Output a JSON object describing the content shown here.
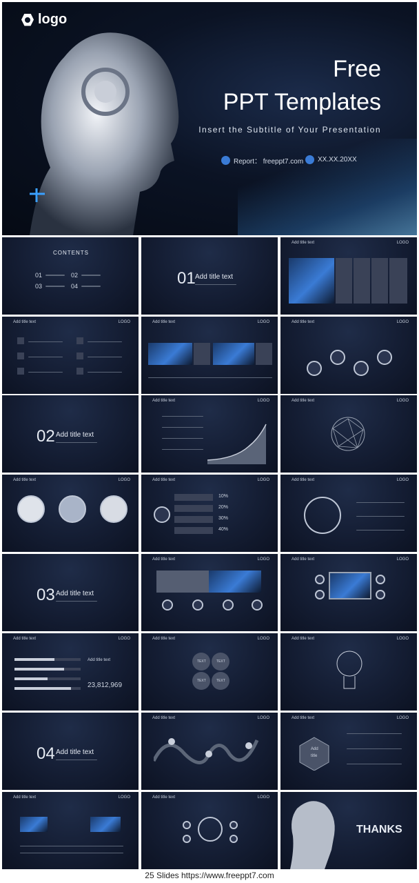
{
  "hero": {
    "logo_text": "logo",
    "title_line1": "Free",
    "title_line2": "PPT Templates",
    "subtitle": "Insert  the  Subtitle  of  Your  Presentation",
    "report": "Report： freeppt7.com",
    "date": "XX.XX.20XX"
  },
  "slides": {
    "contents": "CONTENTS",
    "header": "Add title text",
    "logo": "LOGO",
    "c1": "01",
    "c2": "02",
    "c3": "03",
    "c4": "04",
    "sec_title": "Add title text",
    "text_label": "TEXT",
    "number": "23,812,969",
    "pct1": "10%",
    "pct2": "20%",
    "pct3": "30%",
    "pct4": "40%",
    "add": "Add",
    "title_word": "title",
    "thanks": "THANKS"
  },
  "footer": {
    "text": "25 Slides  https://www.freeppt7.com"
  }
}
